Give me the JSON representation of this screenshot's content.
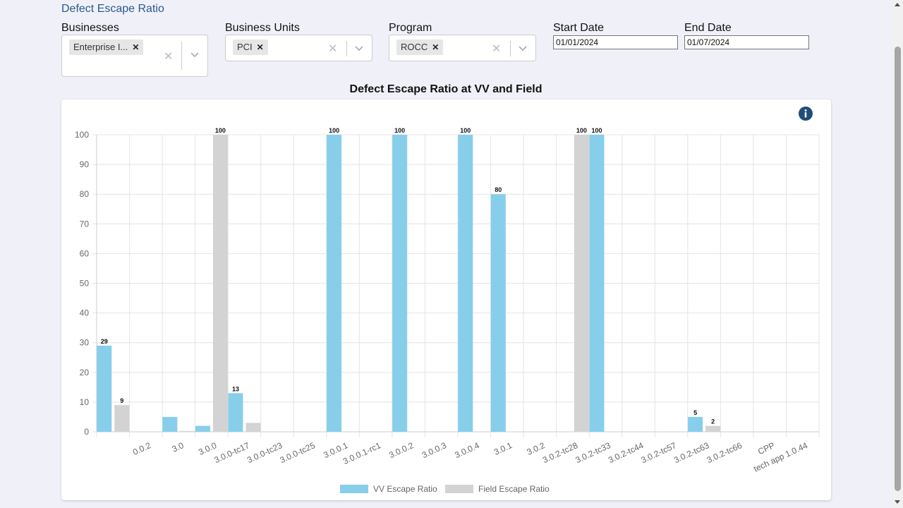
{
  "page": {
    "title": "Defect Escape Ratio"
  },
  "filters": {
    "businesses": {
      "label": "Businesses",
      "chips": [
        "Enterprise I..."
      ]
    },
    "business_units": {
      "label": "Business Units",
      "chips": [
        "PCI"
      ]
    },
    "program": {
      "label": "Program",
      "chips": [
        "ROCC"
      ]
    },
    "start_date": {
      "label": "Start Date",
      "value": "01/01/2024"
    },
    "end_date": {
      "label": "End Date",
      "value": "01/07/2024"
    }
  },
  "chart_title": "Defect Escape Ratio at VV and Field",
  "colors": {
    "vv": "#87ceeb",
    "field": "#d3d3d3",
    "info": "#1f4e79",
    "link": "#2a5a8c"
  },
  "icons": {
    "info": "info-icon",
    "clear": "close-icon",
    "dropdown": "chevron-down-icon"
  },
  "chart_data": {
    "type": "bar",
    "title": "Defect Escape Ratio at VV and Field",
    "ylim": [
      0,
      100
    ],
    "yticks": [
      0,
      10,
      20,
      30,
      40,
      50,
      60,
      70,
      80,
      90,
      100
    ],
    "categories": [
      "",
      "0.0.2",
      "3.0",
      "3.0.0",
      "3.0.0-tc17",
      "3.0.0-tc23",
      "3.0.0-tc25",
      "3.0.0.1",
      "3.0.0.1-rc1",
      "3.0.0.2",
      "3.0.0.3",
      "3.0.0.4",
      "3.0.1",
      "3.0.2",
      "3.0.2-tc28",
      "3.0.2-tc33",
      "3.0.2-tc44",
      "3.0.2-tc57",
      "3.0.2-tc63",
      "3.0.2-tc66",
      "CPP",
      "tech app 1.0.44"
    ],
    "series": [
      {
        "name": "VV Escape Ratio",
        "values": [
          29,
          null,
          5,
          2,
          13,
          null,
          null,
          100,
          null,
          100,
          null,
          100,
          80,
          null,
          null,
          100,
          null,
          null,
          5,
          null,
          null,
          null
        ]
      },
      {
        "name": "Field Escape Ratio",
        "values": [
          9,
          null,
          0.3,
          100,
          3,
          null,
          null,
          null,
          null,
          null,
          null,
          null,
          null,
          null,
          100,
          null,
          null,
          null,
          2,
          null,
          null,
          null
        ]
      }
    ],
    "data_labels": [
      [
        29,
        null,
        null,
        null,
        13,
        null,
        null,
        100,
        null,
        100,
        null,
        100,
        80,
        null,
        null,
        100,
        null,
        null,
        5,
        null,
        null,
        null
      ],
      [
        9,
        null,
        null,
        100,
        null,
        null,
        null,
        null,
        null,
        null,
        null,
        null,
        null,
        null,
        100,
        null,
        null,
        null,
        2,
        null,
        null,
        null
      ]
    ],
    "grid": true,
    "legend": "bottom"
  }
}
